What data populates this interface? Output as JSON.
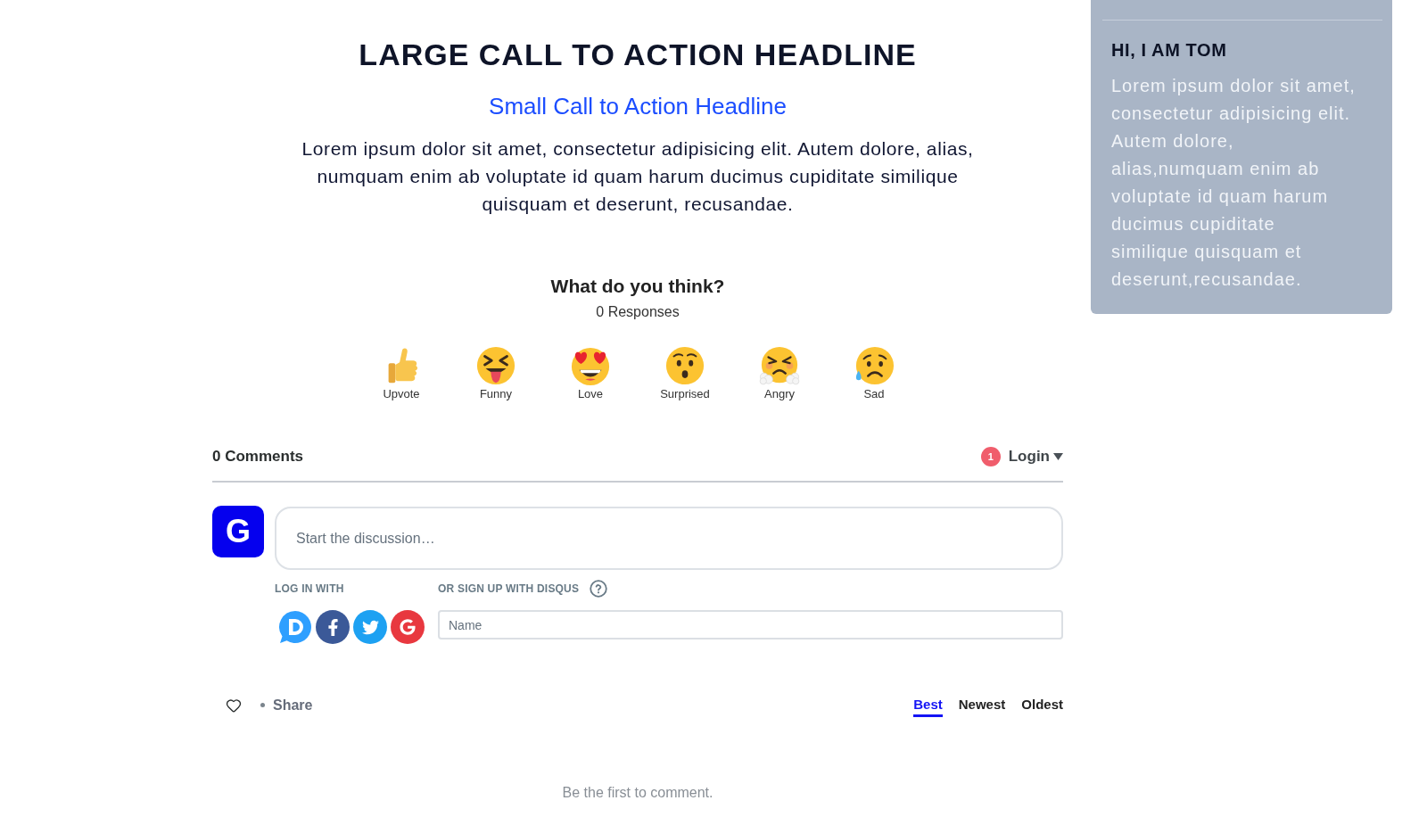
{
  "hero": {
    "headline": "LARGE CALL TO ACTION HEADLINE",
    "subheadline": "Small Call to Action Headline",
    "body": "Lorem ipsum dolor sit amet, consectetur adipisicing elit. Autem dolore, alias, numquam enim ab voluptate id quam harum ducimus cupiditate similique quisquam et deserunt, recusandae."
  },
  "reactions": {
    "title": "What do you think?",
    "count": "0 Responses",
    "items": [
      {
        "kind": "thumbsup",
        "label": "Upvote"
      },
      {
        "kind": "tongue",
        "label": "Funny"
      },
      {
        "kind": "hearteyes",
        "label": "Love"
      },
      {
        "kind": "surprised",
        "label": "Surprised"
      },
      {
        "kind": "angry",
        "label": "Angry"
      },
      {
        "kind": "sad",
        "label": "Sad"
      }
    ]
  },
  "comments": {
    "count": "0 Comments",
    "notifications": "1",
    "login": "Login",
    "avatar_letter": "G",
    "composer": {
      "placeholder": "Start the discussion…"
    },
    "login_label": "LOG IN WITH",
    "signup_label": "OR SIGN UP WITH DISQUS",
    "name_field": {
      "placeholder": "Name"
    },
    "share": "Share",
    "sort_tabs": [
      {
        "label": "Best",
        "selected": true
      },
      {
        "label": "Newest",
        "selected": false
      },
      {
        "label": "Oldest",
        "selected": false
      }
    ],
    "empty_message": "Be the first to comment."
  },
  "sidebar": {
    "title": "HI, I AM TOM",
    "body": "Lorem ipsum dolor sit amet, consectetur adipisicing elit. Autem dolore, alias,numquam enim ab voluptate id quam harum ducimus cupiditate similique quisquam et deserunt,recusandae."
  }
}
